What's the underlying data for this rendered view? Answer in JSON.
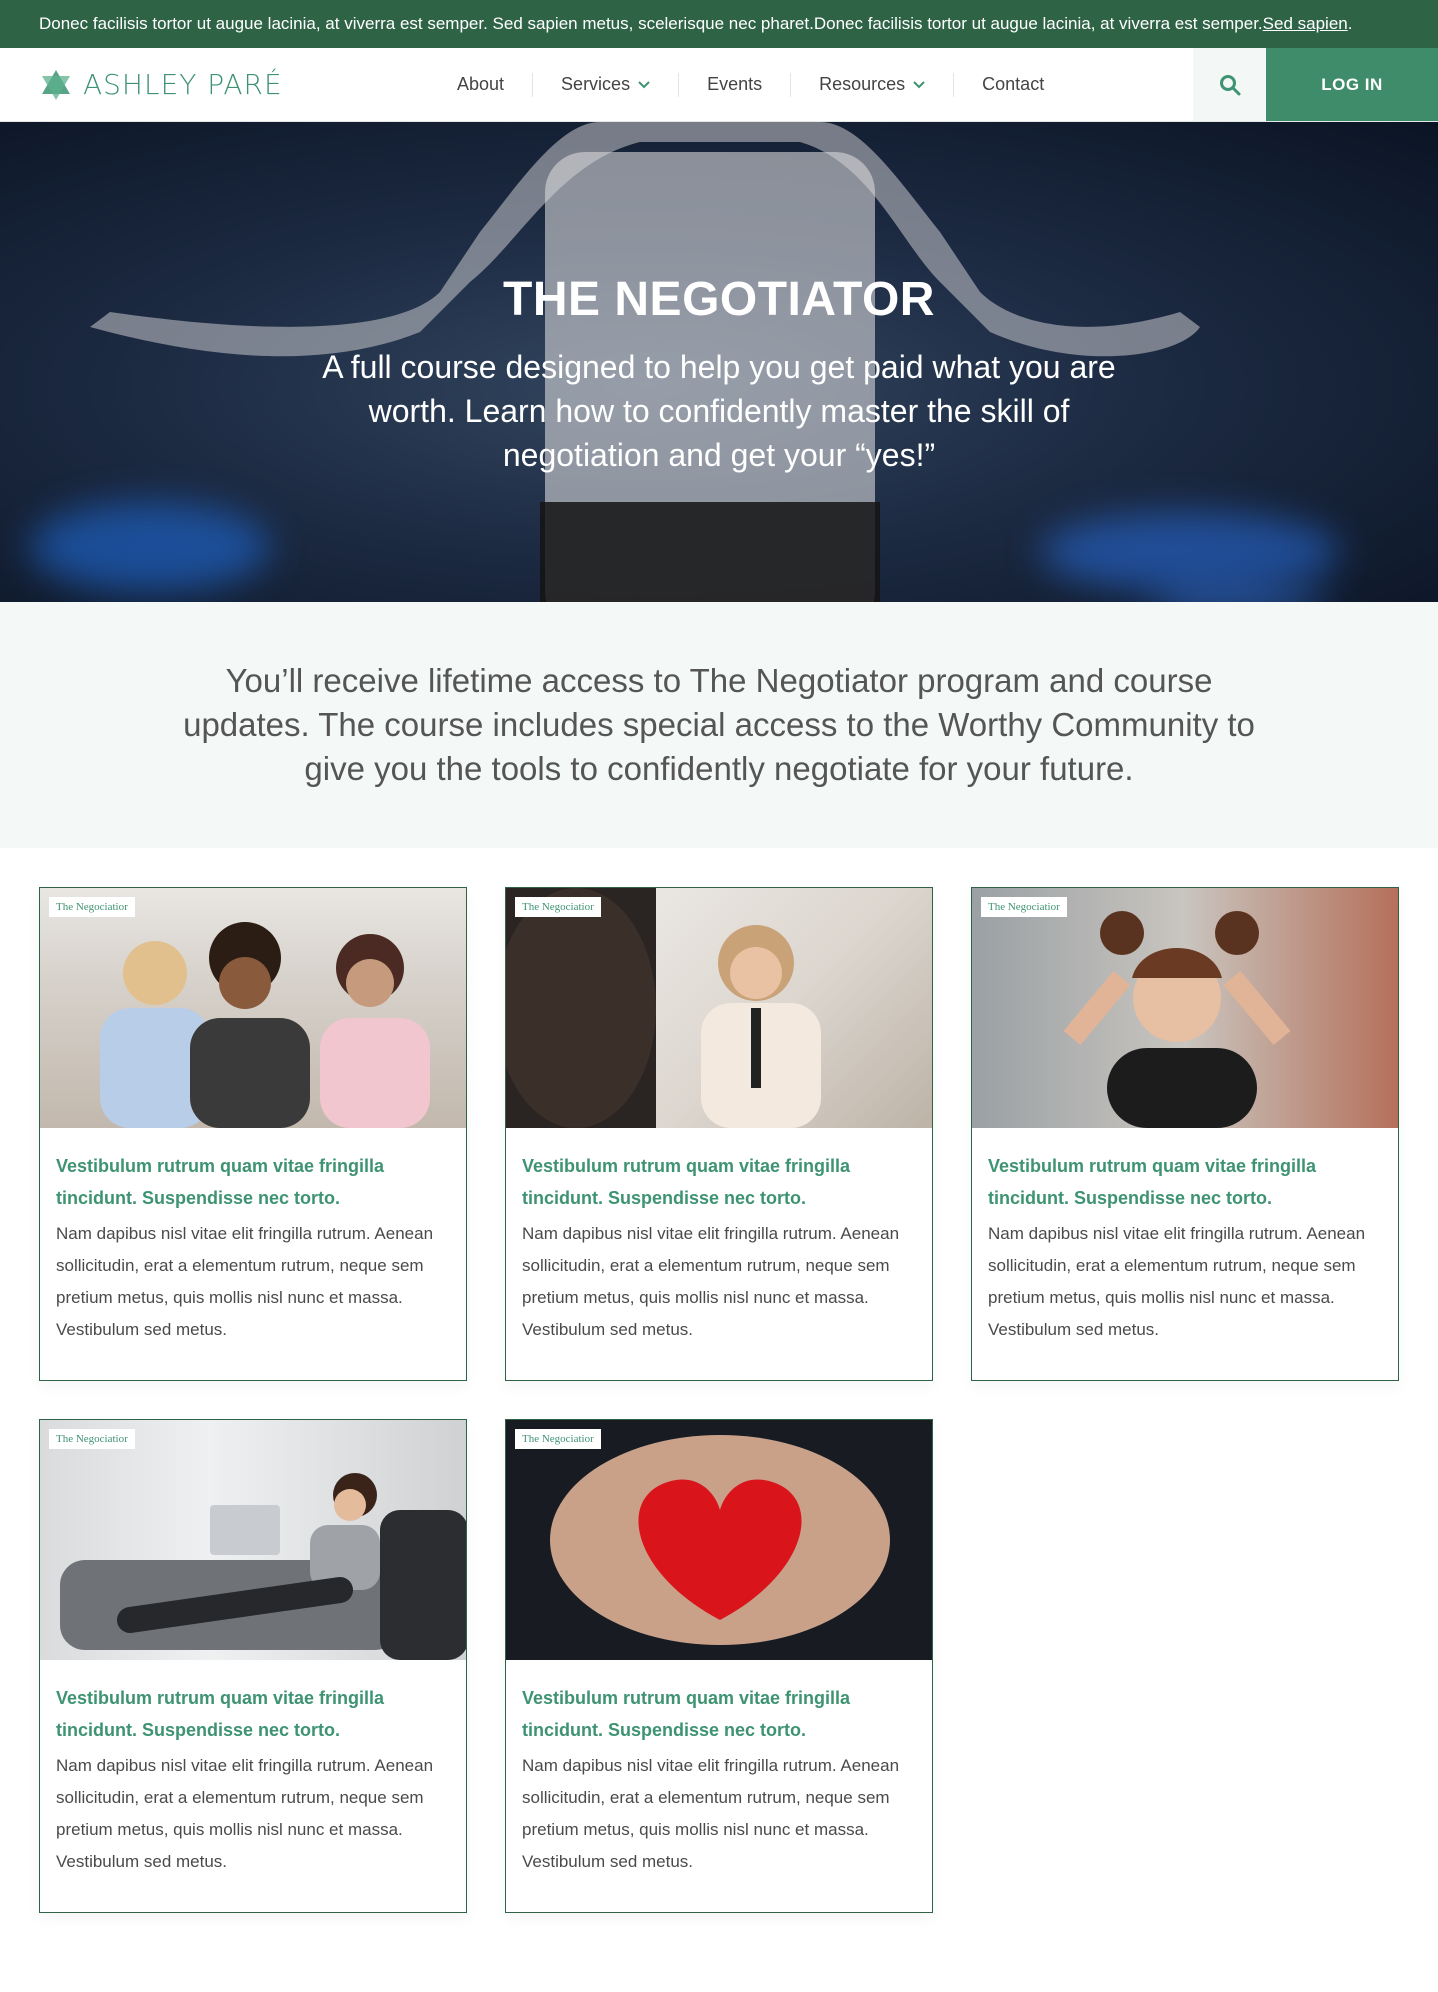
{
  "announcement": {
    "text": "Donec facilisis tortor ut augue lacinia, at viverra est semper. Sed sapien metus, scelerisque nec pharet.Donec facilisis tortor ut augue lacinia, at viverra est semper. ",
    "link": "Sed sapien",
    "trail": "."
  },
  "header": {
    "logo": "ASHLEY PARÉ",
    "menu": [
      "About",
      "Services",
      "Events",
      "Resources",
      "Contact"
    ],
    "login": "LOG IN"
  },
  "hero": {
    "title": "THE NEGOTIATOR",
    "subtitle": "A full course designed to help you get paid what you are worth. Learn how to confidently master the skill of negotiation and get your “yes!”"
  },
  "intro": {
    "text": "You’ll receive lifetime access to The Negotiator program and course updates. The course includes special access to the Worthy Community to give you the tools to confidently negotiate for your future."
  },
  "cards": [
    {
      "tag": "The Negociatior",
      "title": "Vestibulum rutrum quam vitae fringilla tincidunt. Suspendisse nec torto.",
      "text": "Nam dapibus nisl vitae elit fringilla rutrum. Aenean sollicitudin, erat a elementum rutrum, neque sem pretium metus, quis mollis nisl nunc et massa. Vestibulum sed metus."
    },
    {
      "tag": "The Negociatior",
      "title": "Vestibulum rutrum quam vitae fringilla tincidunt. Suspendisse nec torto.",
      "text": "Nam dapibus nisl vitae elit fringilla rutrum. Aenean sollicitudin, erat a elementum rutrum, neque sem pretium metus, quis mollis nisl nunc et massa. Vestibulum sed metus."
    },
    {
      "tag": "The Negociatior",
      "title": "Vestibulum rutrum quam vitae fringilla tincidunt. Suspendisse nec torto.",
      "text": "Nam dapibus nisl vitae elit fringilla rutrum. Aenean sollicitudin, erat a elementum rutrum, neque sem pretium metus, quis mollis nisl nunc et massa. Vestibulum sed metus."
    },
    {
      "tag": "The Negociatior",
      "title": "Vestibulum rutrum quam vitae fringilla tincidunt. Suspendisse nec torto.",
      "text": "Nam dapibus nisl vitae elit fringilla rutrum. Aenean sollicitudin, erat a elementum rutrum, neque sem pretium metus, quis mollis nisl nunc et massa. Vestibulum sed metus."
    },
    {
      "tag": "The Negociatior",
      "title": "Vestibulum rutrum quam vitae fringilla tincidunt. Suspendisse nec torto.",
      "text": "Nam dapibus nisl vitae elit fringilla rutrum. Aenean sollicitudin, erat a elementum rutrum, neque sem pretium metus, quis mollis nisl nunc et massa. Vestibulum sed metus."
    }
  ],
  "colors": {
    "brand_dark": "#2f6346",
    "brand": "#3f8c6a",
    "accent_text": "#3e9372"
  }
}
